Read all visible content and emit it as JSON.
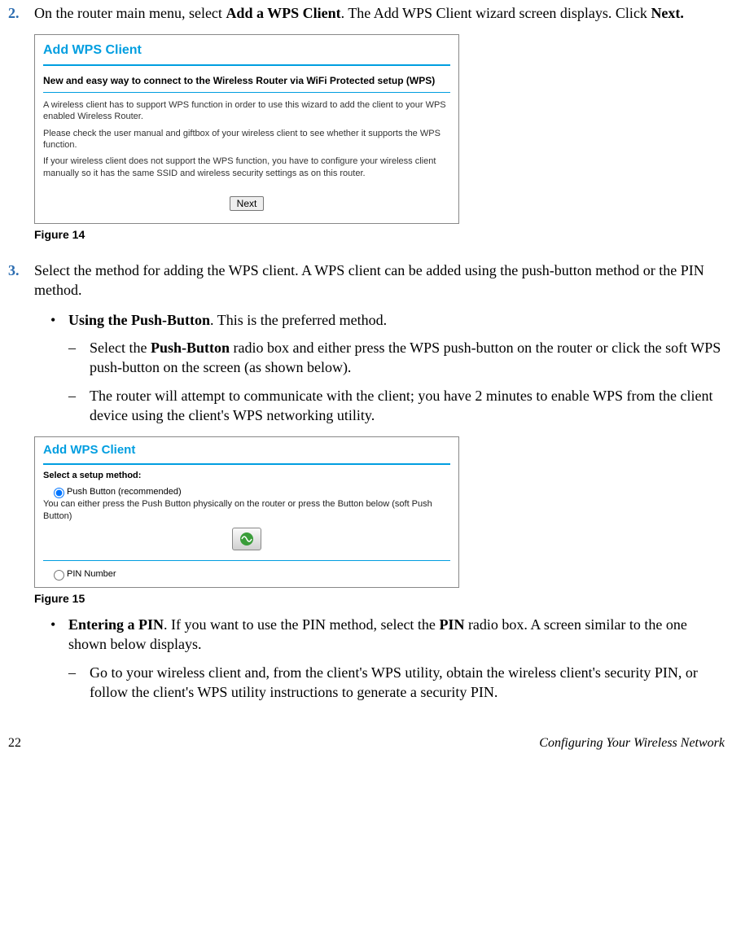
{
  "step2": {
    "num": "2.",
    "text_pre": "On the router main menu, select ",
    "text_bold1": "Add a WPS Client",
    "text_mid": ". The Add WPS Client wizard screen displays. Click ",
    "text_bold2": "Next."
  },
  "fig14": {
    "title": "Add WPS Client",
    "subtitle": "New and easy way to connect to the Wireless Router via WiFi Protected setup (WPS)",
    "para1": "A wireless client has to support WPS function in order to use this wizard to add the client to your WPS enabled Wireless Router.",
    "para2": "Please check the user manual and giftbox of your wireless client to see whether it supports the WPS function.",
    "para3": "If your wireless client does not support the WPS function, you have to configure your wireless client manually so it has the same SSID and wireless security settings as on this router.",
    "button": "Next",
    "caption": "Figure 14"
  },
  "step3": {
    "num": "3.",
    "text": "Select the method for adding the WPS client. A WPS client can be added using the push-button method or the PIN method."
  },
  "pushbutton": {
    "lead_bold": "Using the Push-Button",
    "lead_rest": ". This is the preferred method.",
    "dash1_pre": "Select the ",
    "dash1_bold": "Push-Button",
    "dash1_post": " radio box and either press the WPS push-button on the router or click the soft WPS push-button on the screen (as shown below).",
    "dash2": "The router will attempt to communicate with the client; you have 2 minutes to enable WPS from the client device using the client's WPS networking utility."
  },
  "fig15": {
    "title": "Add WPS Client",
    "select_label": "Select a setup method:",
    "radio1": "Push Button (recommended)",
    "desc": "You can either press the Push Button physically on the router or press the Button below (soft Push Button)",
    "radio2": "PIN Number",
    "caption": "Figure 15"
  },
  "pin": {
    "lead_bold": "Entering a PIN",
    "lead_mid": ". If you want to use the PIN method, select the ",
    "lead_bold2": "PIN",
    "lead_rest": " radio box. A screen similar to the one shown below displays.",
    "dash1": "Go to your wireless client and, from the client's WPS utility, obtain the wireless client's security PIN, or follow the client's WPS utility instructions to generate a security PIN."
  },
  "footer": {
    "page": "22",
    "section": "Configuring Your Wireless Network"
  }
}
